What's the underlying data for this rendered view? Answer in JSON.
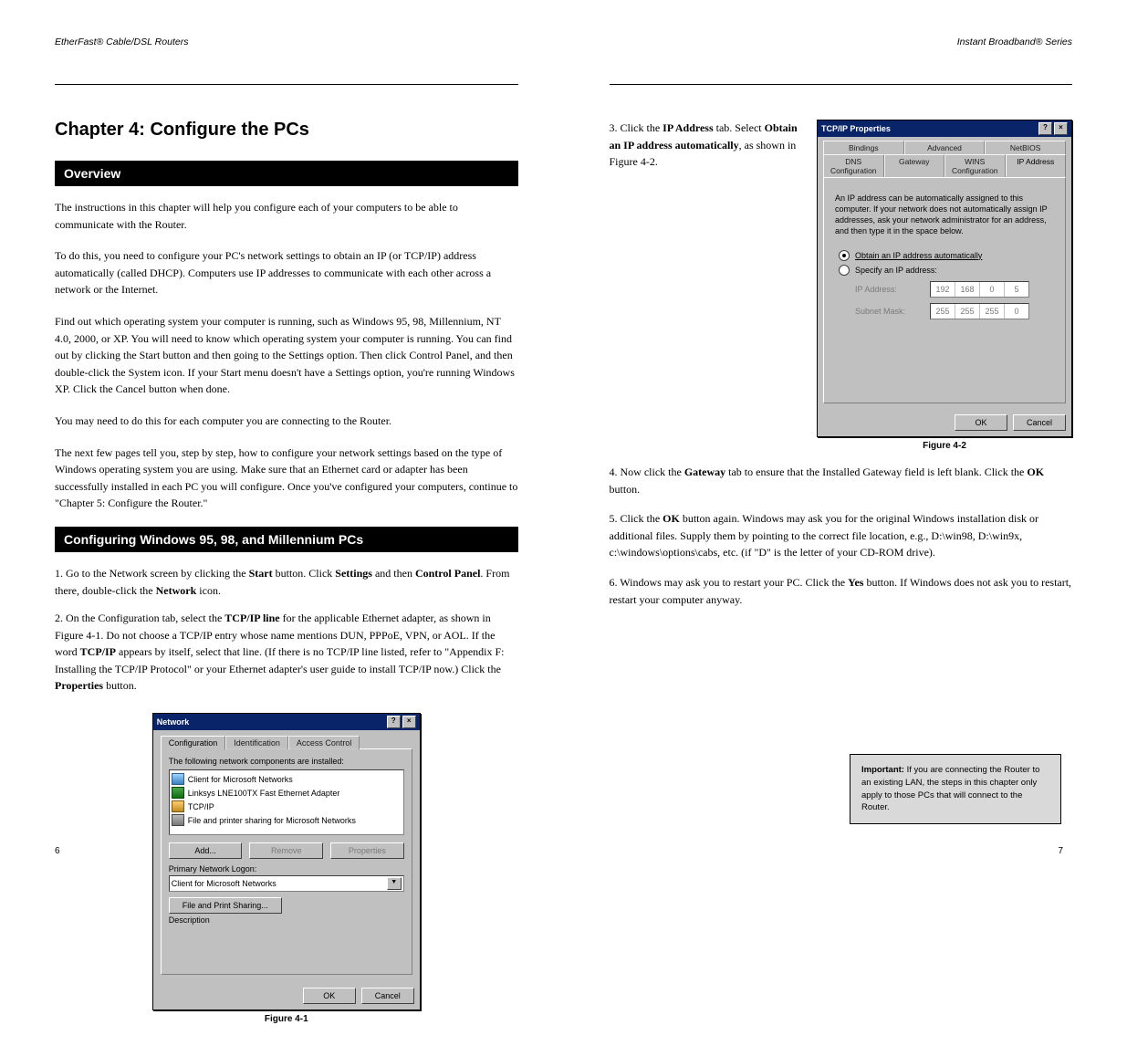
{
  "page6": {
    "header_left": "EtherFast® Cable/DSL Routers",
    "chapter_title": "Chapter 4: Configure the PCs",
    "overview_heading": "Overview",
    "overview_p1": "The instructions in this chapter will help you configure each of your computers to be able to communicate with the Router.",
    "overview_p2_a": "To do this, you need to configure your PC's network settings to obtain an IP (or TCP/IP) address automatically (called DHCP). Computers use IP addresses to communicate with each other across a network or the Internet.",
    "overview_p3": "Find out which operating system your computer is running, such as Windows 95, 98, Millennium, NT 4.0, 2000, or XP. You will need to know which operating system your computer is running. You can find out by clicking the Start button and then going to the Settings option. Then click Control Panel, and then double-click the System icon. If your Start menu doesn't have a Settings option, you're running Windows XP. Click the Cancel button when done.",
    "overview_p4": "You may need to do this for each computer you are connecting to the Router.",
    "overview_p5_a": "The next few pages tell you, step by step, how to configure your network settings based on the type of Windows operating system you are using. Make sure that an Ethernet card or adapter has been successfully installed in each PC you will configure. Once you've configured your computers, continue to \"Chapter 5: Configure the Router.\"",
    "cfg_heading": "Configuring Windows 95, 98, and Millennium PCs",
    "step1_a": "1. Go to the Network screen by clicking the ",
    "step1_b": "Start",
    "step1_c": " button. Click ",
    "step1_d": "Settings",
    "step1_e": " and then ",
    "step1_f": "Control Panel",
    "step1_g": ". From there, double-click the ",
    "step1_h": "Network",
    "step1_i": " icon.",
    "step2_a": "2. On the Configuration tab, select the ",
    "step2_b": "TCP/IP line",
    "step2_c": " for the applicable Ethernet adapter, as shown in Figure 4-1. Do not choose a TCP/IP entry whose name mentions DUN, PPPoE, VPN, or AOL. If the word ",
    "step2_d": "TCP/IP",
    "step2_e": " appears by itself, select that line. (If there is no TCP/IP line listed, refer to \"Appendix F: Installing the TCP/IP Protocol\" or your Ethernet adapter's user guide to install TCP/IP now.) Click the ",
    "step2_f": "Properties",
    "step2_g": " button.",
    "network_dialog": {
      "title": "Network",
      "tabs": [
        "Configuration",
        "Identification",
        "Access Control"
      ],
      "list_label": "The following network components are installed:",
      "items": [
        "Client for Microsoft Networks",
        "Linksys LNE100TX Fast Ethernet Adapter",
        "TCP/IP",
        "File and printer sharing for Microsoft Networks"
      ],
      "add": "Add...",
      "remove": "Remove",
      "properties": "Properties",
      "primary_label": "Primary Network Logon:",
      "primary_value": "Client for Microsoft Networks",
      "fileprint": "File and Print Sharing...",
      "desc_label": "Description",
      "ok": "OK",
      "cancel": "Cancel"
    },
    "fig41": "Figure 4-1",
    "page_no": "6"
  },
  "page7": {
    "header_right": "Instant Broadband® Series",
    "step3_a": "3. Click the ",
    "step3_b": "IP Address",
    "step3_c": " tab. Select ",
    "step3_d": "Obtain an IP address automatically",
    "step3_e": ", as shown in Figure 4-2.",
    "tcpip_dialog": {
      "title": "TCP/IP Properties",
      "tabs_row1": [
        "Bindings",
        "Advanced",
        "NetBIOS"
      ],
      "tabs_row2": [
        "DNS Configuration",
        "Gateway",
        "WINS Configuration",
        "IP Address"
      ],
      "desc": "An IP address can be automatically assigned to this computer. If your network does not automatically assign IP addresses, ask your network administrator for an address, and then type it in the space below.",
      "radio_auto": "Obtain an IP address automatically",
      "radio_spec": "Specify an IP address:",
      "ip_label": "IP Address:",
      "ip_vals": [
        "192",
        "168",
        "0",
        "5"
      ],
      "mask_label": "Subnet Mask:",
      "mask_vals": [
        "255",
        "255",
        "255",
        "0"
      ],
      "ok": "OK",
      "cancel": "Cancel"
    },
    "fig42": "Figure 4-2",
    "step4_a": "4. Now click the ",
    "step4_b": "Gateway",
    "step4_c": " tab to ensure that the Installed Gateway field is left blank. Click the ",
    "step4_d": "OK",
    "step4_e": " button.",
    "step5_a": "5. Click the ",
    "step5_b": "OK",
    "step5_c": " button again. Windows may ask you for the original Windows installation disk or additional files. Supply them by pointing to the correct file location, e.g., D:\\win98, D:\\win9x, c:\\windows\\options\\cabs, etc. (if \"D\" is the letter of your CD-ROM drive).",
    "step6_a": "6. Windows may ask you to restart your PC. Click the ",
    "step6_b": "Yes",
    "step6_c": " button. If Windows does not ask you to restart, restart your computer anyway.",
    "note_label": "Important:",
    "note_text": " If you are connecting the Router to an existing LAN, the steps in this chapter only apply to those PCs that will connect to the Router.",
    "page_no": "7"
  }
}
